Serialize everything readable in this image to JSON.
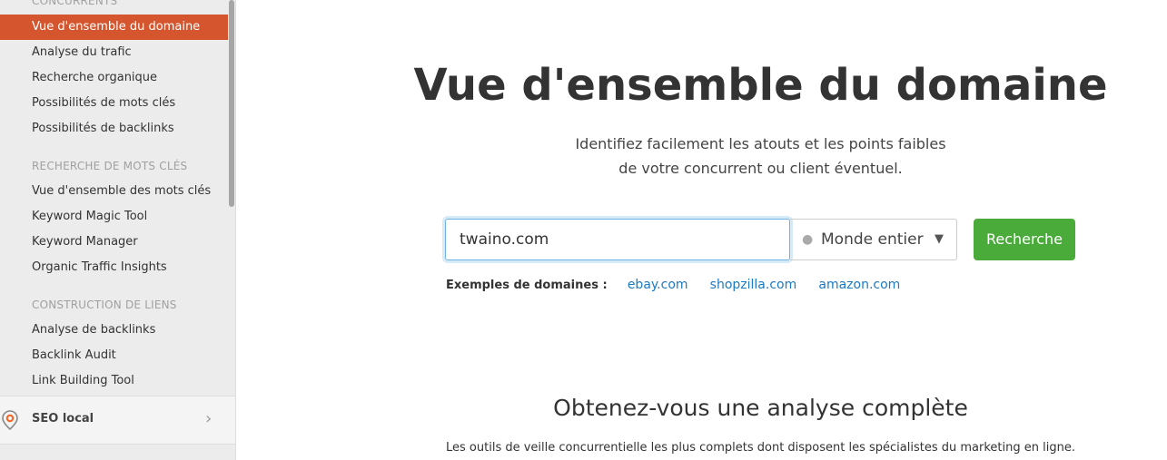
{
  "sidebar": {
    "sections": [
      "CONCURRENTS",
      "RECHERCHE DE MOTS CLÉS",
      "CONSTRUCTION DE LIENS"
    ],
    "items": [
      "Vue d'ensemble du domaine",
      "Analyse du trafic",
      "Recherche organique",
      "Possibilités de mots clés",
      "Possibilités de backlinks",
      "Vue d'ensemble des mots clés",
      "Keyword Magic Tool",
      "Keyword Manager",
      "Organic Traffic Insights",
      "Analyse de backlinks",
      "Backlink Audit",
      "Link Building Tool"
    ],
    "active": "Vue d'ensemble du domaine",
    "local": "SEO local"
  },
  "main": {
    "title": "Vue d'ensemble du domaine",
    "subtitle1": "Identifiez facilement les atouts et les points faibles",
    "subtitle2": "de votre concurrent ou client éventuel.",
    "search_value": "twaino.com",
    "region": "Monde entier",
    "button": "Recherche",
    "examples_label": "Exemples de domaines :",
    "examples": [
      "ebay.com",
      "shopzilla.com",
      "amazon.com"
    ],
    "h2": "Obtenez-vous une analyse complète",
    "p2": "Les outils de veille concurrentielle les plus complets dont disposent les spécialistes du marketing en ligne."
  },
  "colors": {
    "active": "#d5562e",
    "button": "#4aab3a",
    "link": "#1a7ac5"
  }
}
